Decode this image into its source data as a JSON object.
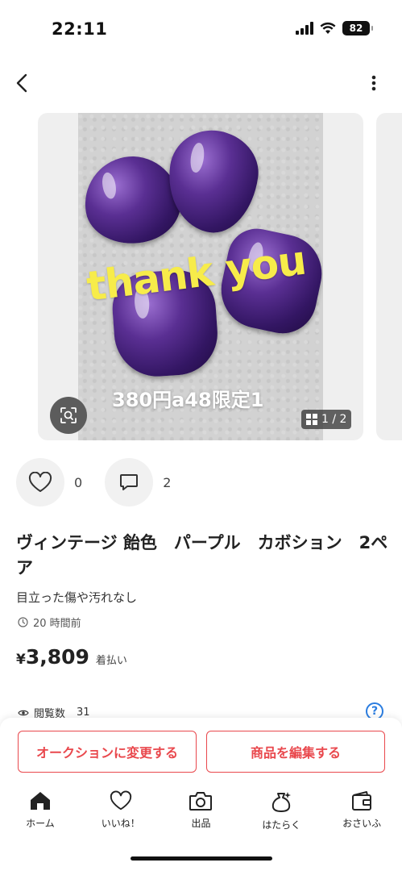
{
  "status_bar": {
    "time": "22:11",
    "battery": "82"
  },
  "listing": {
    "photo_caption": "thank you",
    "photo_subcaption": "380円a48限定1",
    "page_indicator": "1 / 2",
    "likes": "0",
    "comments": "2",
    "title": "ヴィンテージ 飴色　パープル　カボション　2ペア",
    "subtitle": "目立った傷や汚れなし",
    "posted": "20 時間前",
    "price_yen": "¥",
    "price": "3,809",
    "shipping": "着払い",
    "views_label": "閲覧数",
    "views_count": "31"
  },
  "actions": {
    "auction_button": "オークションに変更する",
    "edit_button": "商品を編集する"
  },
  "tabs": [
    {
      "label": "ホーム",
      "icon": "home-icon"
    },
    {
      "label": "いいね！",
      "icon": "heart-icon"
    },
    {
      "label": "出品",
      "icon": "camera-icon"
    },
    {
      "label": "はたらく",
      "icon": "money-bag-icon"
    },
    {
      "label": "おさいふ",
      "icon": "wallet-icon"
    }
  ],
  "colors": {
    "accent": "#e9484d",
    "help": "#2b7de0",
    "stone": "#4a1f80",
    "caption": "#f7ec4a"
  }
}
